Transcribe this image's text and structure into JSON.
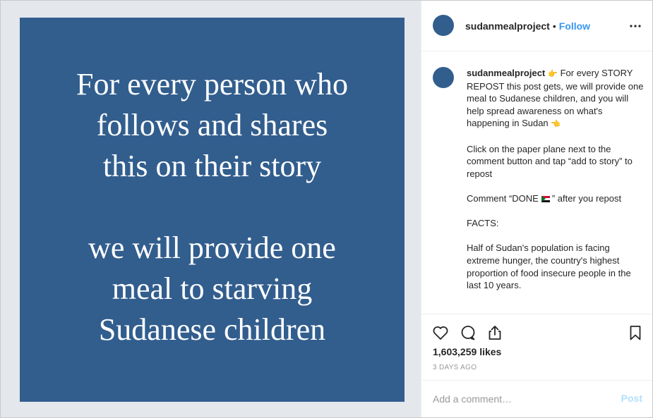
{
  "image": {
    "headline": "For every person who\nfollows and shares\nthis on their story",
    "subline": "we will provide one\nmeal to starving\nSudanese children",
    "background_color": "#325e8e"
  },
  "header": {
    "username": "sudanmealproject",
    "separator": "•",
    "follow_label": "Follow",
    "more_icon": "more-horizontal-icon"
  },
  "caption": {
    "username": "sudanmealproject",
    "emoji_right": "👉",
    "intro_rest": "For every STORY REPOST this post gets, we will provide one meal to Sudanese children, and you will help spread awareness on what's happening in Sudan",
    "emoji_left": "👈",
    "instructions": "Click on the paper plane next to the comment button and tap “add to story” to repost",
    "comment_before": "Comment “DONE",
    "flag_icon": "sudan-flag-icon",
    "comment_after": "” after you repost",
    "facts_heading": "FACTS:",
    "fact_1": "Half of Sudan's population is facing extreme hunger, the country's highest proportion of food insecure people in the last 10 years."
  },
  "actions": {
    "like_icon": "heart-icon",
    "comment_icon": "comment-bubble-icon",
    "share_icon": "share-icon",
    "save_icon": "bookmark-icon",
    "likes_count": "1,603,259",
    "likes_label": "likes",
    "date": "3 DAYS AGO"
  },
  "comment_box": {
    "placeholder": "Add a comment…",
    "post_label": "Post"
  },
  "colors": {
    "accent": "#3897f0",
    "post_disabled": "#b2dffc",
    "media_bg": "#e4e7ec"
  }
}
